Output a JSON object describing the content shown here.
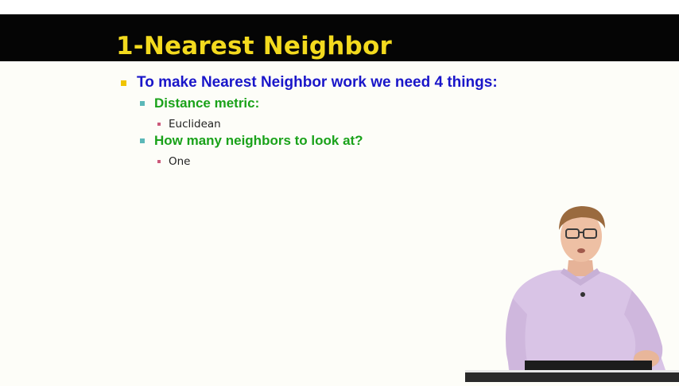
{
  "slide": {
    "title": "1-Nearest Neighbor",
    "bullets": [
      {
        "level": 1,
        "text": "To make Nearest Neighbor work we need 4 things:"
      },
      {
        "level": 2,
        "text": "Distance metric:"
      },
      {
        "level": 3,
        "text": "Euclidean"
      },
      {
        "level": 2,
        "text": "How many neighbors to look at?"
      },
      {
        "level": 3,
        "text": "One"
      }
    ]
  },
  "colors": {
    "title_bar": "#050505",
    "title_text": "#f3da1e",
    "level1_text": "#1a16c9",
    "level2_text": "#1aa21a",
    "level1_bullet": "#f0c400",
    "level2_bullet": "#5bb8b8",
    "level3_bullet": "#cc5a7a"
  },
  "presenter": {
    "description_icon": "presenter-video"
  }
}
